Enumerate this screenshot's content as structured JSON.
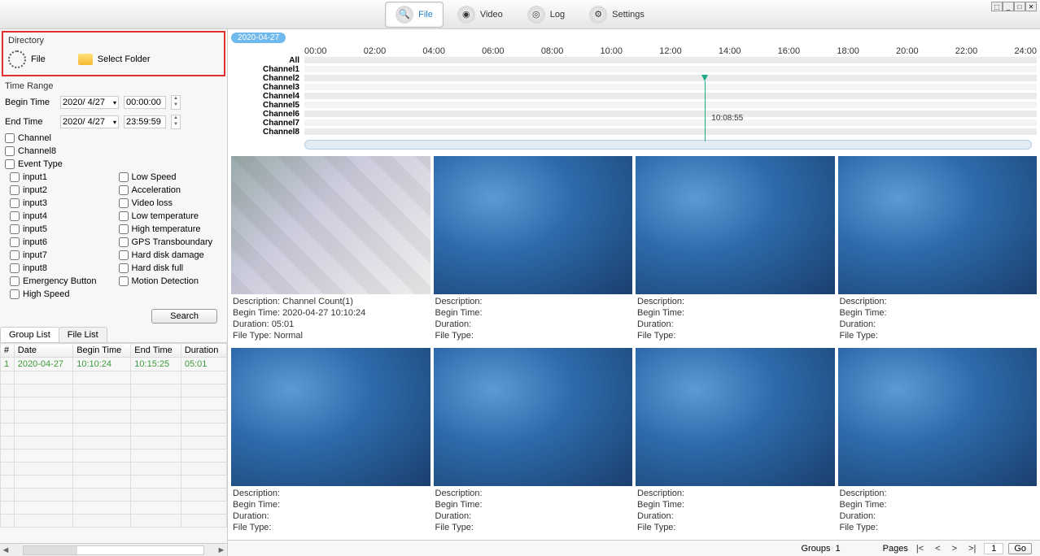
{
  "toolbar": {
    "tabs": [
      {
        "label": "File",
        "active": true,
        "icon": "search-icon"
      },
      {
        "label": "Video",
        "active": false,
        "icon": "camera-icon"
      },
      {
        "label": "Log",
        "active": false,
        "icon": "disc-icon"
      },
      {
        "label": "Settings",
        "active": false,
        "icon": "gear-icon"
      }
    ]
  },
  "directory": {
    "title": "Directory",
    "file_label": "File",
    "select_folder_label": "Select Folder"
  },
  "time_range": {
    "title": "Time Range",
    "begin_label": "Begin Time",
    "end_label": "End Time",
    "begin_date": "2020/ 4/27",
    "begin_time": "00:00:00",
    "end_date": "2020/ 4/27",
    "end_time": "23:59:59"
  },
  "channel": {
    "header": "Channel",
    "items": [
      "Channel8"
    ]
  },
  "event_type": {
    "header": "Event Type",
    "col1": [
      "input1",
      "input2",
      "input3",
      "input4",
      "input5",
      "input6",
      "input7",
      "input8",
      "Emergency Button",
      "High Speed"
    ],
    "col2": [
      "Low Speed",
      "Acceleration",
      "Video loss",
      "Low temperature",
      "High temperature",
      "GPS Transboundary",
      "Hard disk damage",
      "Hard disk full",
      "Motion Detection"
    ]
  },
  "search_label": "Search",
  "list_tabs": {
    "group": "Group List",
    "file": "File List"
  },
  "file_table": {
    "headers": [
      "#",
      "Date",
      "Begin Time",
      "End Time",
      "Duration"
    ],
    "rows": [
      {
        "n": "1",
        "date": "2020-04-27",
        "begin": "10:10:24",
        "end": "10:15:25",
        "dur": "05:01"
      }
    ]
  },
  "timeline": {
    "date_badge": "2020-04-27",
    "hours": [
      "00:00",
      "02:00",
      "04:00",
      "06:00",
      "08:00",
      "10:00",
      "12:00",
      "14:00",
      "16:00",
      "18:00",
      "20:00",
      "22:00",
      "24:00"
    ],
    "channels": [
      "All",
      "Channel1",
      "Channel2",
      "Channel3",
      "Channel4",
      "Channel5",
      "Channel6",
      "Channel7",
      "Channel8"
    ],
    "play_time": "10:08:55"
  },
  "cells": [
    {
      "desc": "Description: Channel Count(1)",
      "begin": "Begin Time: 2020-04-27 10:10:24",
      "dur": "Duration: 05:01",
      "ft": "File Type: Normal",
      "cam": true
    },
    {
      "desc": "Description:",
      "begin": "Begin Time:",
      "dur": "Duration:",
      "ft": "File Type:",
      "cam": false
    },
    {
      "desc": "Description:",
      "begin": "Begin Time:",
      "dur": "Duration:",
      "ft": "File Type:",
      "cam": false
    },
    {
      "desc": "Description:",
      "begin": "Begin Time:",
      "dur": "Duration:",
      "ft": "File Type:",
      "cam": false
    },
    {
      "desc": "Description:",
      "begin": "Begin Time:",
      "dur": "Duration:",
      "ft": "File Type:",
      "cam": false
    },
    {
      "desc": "Description:",
      "begin": "Begin Time:",
      "dur": "Duration:",
      "ft": "File Type:",
      "cam": false
    },
    {
      "desc": "Description:",
      "begin": "Begin Time:",
      "dur": "Duration:",
      "ft": "File Type:",
      "cam": false
    },
    {
      "desc": "Description:",
      "begin": "Begin Time:",
      "dur": "Duration:",
      "ft": "File Type:",
      "cam": false
    }
  ],
  "pager": {
    "groups_label": "Groups",
    "groups_val": "1",
    "pages_label": "Pages",
    "first": "|<",
    "prev": "<",
    "next": ">",
    "last": ">|",
    "page_val": "1",
    "go_label": "Go"
  }
}
